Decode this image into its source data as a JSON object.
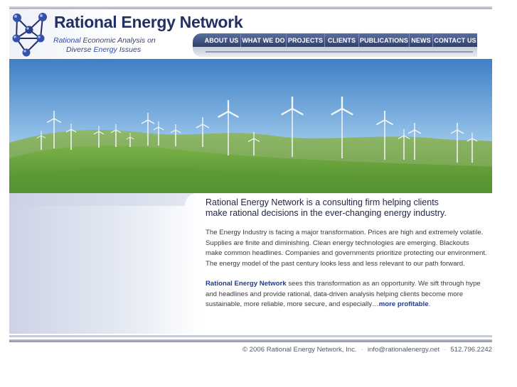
{
  "brand": {
    "name": "Rational Energy Network",
    "tagline_rational": "Rational",
    "tagline_rest1": "Economic Analysis on",
    "tagline_diverse": "Diverse",
    "tagline_energy": "Energy",
    "tagline_issues": "Issues"
  },
  "nav": {
    "items": [
      {
        "label": "ABOUT US"
      },
      {
        "label": "WHAT WE DO"
      },
      {
        "label": "PROJECTS"
      },
      {
        "label": "CLIENTS"
      },
      {
        "label": "PUBLICATIONS"
      },
      {
        "label": "NEWS"
      },
      {
        "label": "CONTACT US"
      }
    ]
  },
  "content": {
    "headline_line1": "Rational Energy Network is a consulting firm helping clients",
    "headline_line2": "make rational decisions in the ever-changing energy industry.",
    "para1": "The Energy Industry is facing a major transformation. Prices are high and extremely volatile. Supplies are finite and diminishing. Clean energy technologies are emerging. Blackouts make common headlines. Companies and governments prioritize protecting our environment. The energy model of the past century looks less and less relevant to our path forward.",
    "para2_brand": "Rational Energy Network",
    "para2_body": " sees this transformation as an opportunity. We sift through hype and headlines and provide rational, data-driven analysis helping clients become more sustainable, more reliable, more secure, and especially…",
    "para2_link": "more profitable",
    "para2_end": "."
  },
  "footer": {
    "copyright": "© 2006 Rational Energy Network, Inc.",
    "sep": "·",
    "email": "info@rationalenergy.net",
    "phone": "512.796.2242"
  },
  "colors": {
    "brand_navy": "#233063",
    "nav_bar": "#2f3f6a",
    "link_blue": "#233a8c",
    "sky_top": "#3f7fc4",
    "grass": "#5f9a3a"
  }
}
